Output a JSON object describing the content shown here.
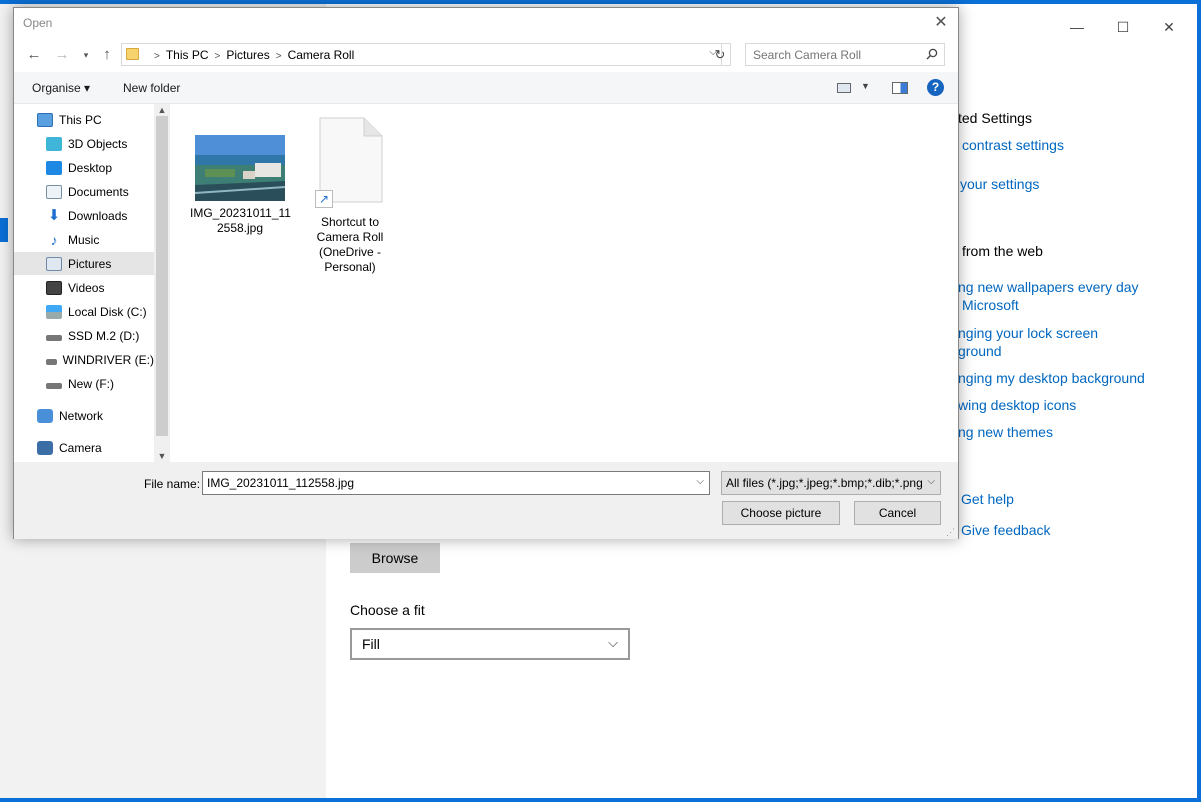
{
  "settings": {
    "window_controls": {
      "minimize": "—",
      "maximize": "☐",
      "close": "✕"
    },
    "right_panel": {
      "heading_related": "ted Settings",
      "link_contrast": "contrast settings",
      "link_sync": "your settings",
      "heading_web": "from the web",
      "link_wallpapers_1": "ng new wallpapers every day",
      "link_wallpapers_2": "Microsoft",
      "link_lockscreen_1": "nging your lock screen",
      "link_lockscreen_2": "ground",
      "link_desktop_bg": "nging my desktop background",
      "link_desktop_icons": "wing desktop icons",
      "link_themes": "ng new themes",
      "link_help": "Get help",
      "link_feedback": "Give feedback"
    },
    "browse_label": "Browse",
    "fit_label": "Choose a fit",
    "fit_value": "Fill"
  },
  "dialog": {
    "title": "Open",
    "path": [
      "This PC",
      "Pictures",
      "Camera Roll"
    ],
    "search_placeholder": "Search Camera Roll",
    "toolbar": {
      "organise": "Organise ▾",
      "new_folder": "New folder"
    },
    "nav_items": [
      {
        "label": "This PC",
        "icon": "pc-icon"
      },
      {
        "label": "3D Objects",
        "icon": "cube-icon"
      },
      {
        "label": "Desktop",
        "icon": "desktop-icon"
      },
      {
        "label": "Documents",
        "icon": "documents-icon"
      },
      {
        "label": "Downloads",
        "icon": "download-icon"
      },
      {
        "label": "Music",
        "icon": "music-icon"
      },
      {
        "label": "Pictures",
        "icon": "pictures-icon",
        "selected": true
      },
      {
        "label": "Videos",
        "icon": "video-icon"
      },
      {
        "label": "Local Disk (C:)",
        "icon": "disk-icon"
      },
      {
        "label": "SSD M.2 (D:)",
        "icon": "drive-icon"
      },
      {
        "label": "WINDRIVER (E:)",
        "icon": "drive-icon"
      },
      {
        "label": "New (F:)",
        "icon": "drive-icon"
      },
      {
        "label": "Network",
        "icon": "network-icon"
      },
      {
        "label": "Camera",
        "icon": "camera-icon"
      }
    ],
    "files": [
      {
        "name_l1": "IMG_20231011_11",
        "name_l2": "2558.jpg",
        "icon": "photo-thumbnail"
      },
      {
        "name_l1": "Shortcut to",
        "name_l2": "Camera Roll",
        "name_l3": "(OneDrive -",
        "name_l4": "Personal)",
        "icon": "shortcut-icon"
      }
    ],
    "file_name_label": "File name:",
    "file_name_value": "IMG_20231011_112558.jpg",
    "file_type_value": "All files (*.jpg;*.jpeg;*.bmp;*.dib;*.png",
    "choose_label": "Choose picture",
    "cancel_label": "Cancel"
  }
}
